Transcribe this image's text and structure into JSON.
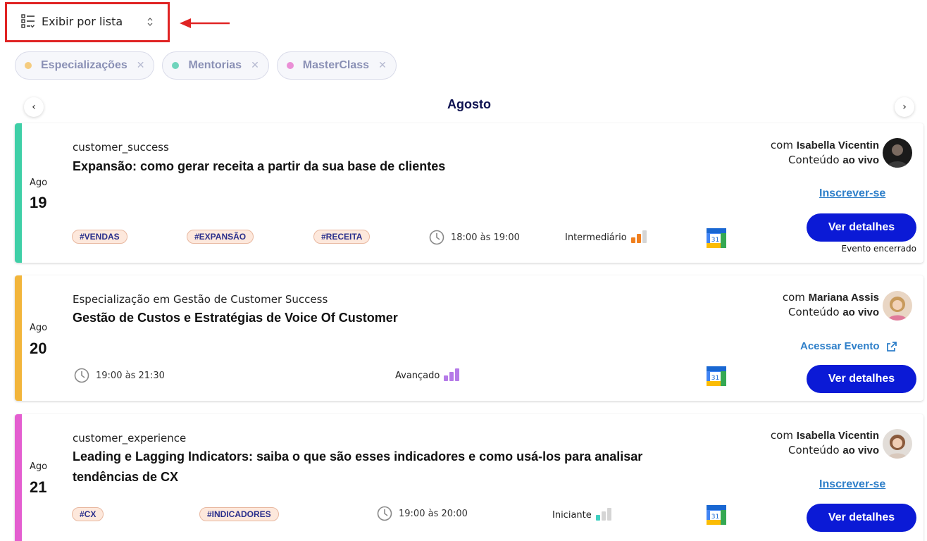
{
  "view": {
    "label": "Exibir por lista"
  },
  "filters": [
    {
      "label": "Especializações",
      "dot_color": "#f5cc7f",
      "remove": "✕"
    },
    {
      "label": "Mentorias",
      "dot_color": "#6fd4bc",
      "remove": "✕"
    },
    {
      "label": "MasterClass",
      "dot_color": "#ea8fd6",
      "remove": "✕"
    }
  ],
  "calendar": {
    "month": "Agosto",
    "prev": "‹",
    "next": "›"
  },
  "events": [
    {
      "accent": "#3fcfa7",
      "month": "Ago",
      "day": "19",
      "category": "customer_success",
      "title": "Expansão: como gerar receita a partir da sua base de clientes",
      "tags": [
        "#VENDAS",
        "#EXPANSÃO",
        "#RECEITA"
      ],
      "time": "18:00 às 19:00",
      "level": "Intermediário",
      "level_value": 2,
      "host_prefix": "com",
      "host": "Isabella Vicentin",
      "content_prefix": "Conteúdo",
      "content_type": "ao vivo",
      "action": "Inscrever-se",
      "details": "Ver detalhes",
      "status": "Evento encerrado",
      "calendar_day": "31"
    },
    {
      "accent": "#f2b53b",
      "month": "Ago",
      "day": "20",
      "category": "Especialização em Gestão de Customer Success",
      "title": "Gestão de Custos e Estratégias de Voice Of Customer",
      "tags": [],
      "time": "19:00 às 21:30",
      "level": "Avançado",
      "level_value": 3,
      "host_prefix": "com",
      "host": "Mariana Assis",
      "content_prefix": "Conteúdo",
      "content_type": "ao vivo",
      "action": "Acessar Evento",
      "details": "Ver detalhes",
      "calendar_day": "31"
    },
    {
      "accent": "#e45ed0",
      "month": "Ago",
      "day": "21",
      "category": "customer_experience",
      "title": "Leading e Lagging Indicators: saiba o que são esses indicadores e como usá-los para analisar tendências de CX",
      "tags": [
        "#CX",
        "#INDICADORES"
      ],
      "time": "19:00 às 20:00",
      "level": "Iniciante",
      "level_value": 1,
      "host_prefix": "com",
      "host": "Isabella Vicentin",
      "content_prefix": "Conteúdo",
      "content_type": "ao vivo",
      "action": "Inscrever-se",
      "details": "Ver detalhes",
      "calendar_day": "31"
    }
  ]
}
